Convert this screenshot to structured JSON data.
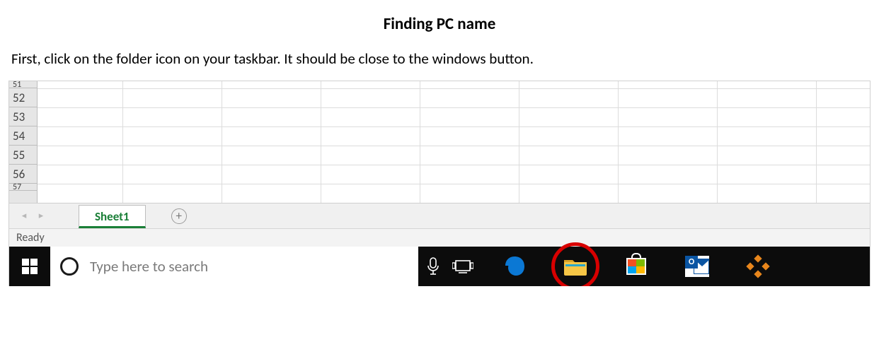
{
  "doc": {
    "title": "Finding PC name",
    "body": "First, click on the folder icon on your taskbar.  It should be close to the windows button."
  },
  "excel": {
    "row_numbers": [
      "51",
      "52",
      "53",
      "54",
      "55",
      "56",
      "57"
    ],
    "sheet_tab": "Sheet1",
    "add_sheet_glyph": "+",
    "status": "Ready",
    "nav_prev_glyph": "◂",
    "nav_next_glyph": "▸"
  },
  "taskbar": {
    "search_placeholder": "Type here to search",
    "outlook_badge": "O"
  },
  "icons": {
    "start": "windows-start-icon",
    "cortana": "cortana-icon",
    "mic": "microphone-icon",
    "taskview": "task-view-icon",
    "edge": "edge-browser-icon",
    "file_explorer": "file-explorer-icon",
    "store": "microsoft-store-icon",
    "outlook": "outlook-icon",
    "app": "orange-dots-app-icon"
  }
}
